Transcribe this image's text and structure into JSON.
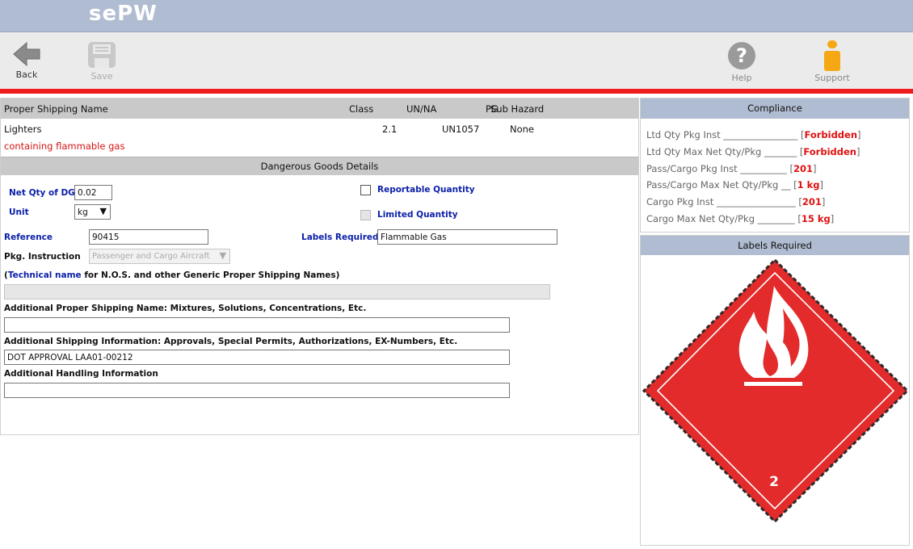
{
  "app": {
    "logo": "sePW"
  },
  "toolbar": {
    "back_label": "Back",
    "save_label": "Save",
    "help_label": "Help",
    "support_label": "Support"
  },
  "shipping_table": {
    "headers": {
      "name": "Proper Shipping Name",
      "class": "Class",
      "un_na": "UN/NA",
      "pg": "PG",
      "sub_hazard": "Sub Hazard"
    },
    "row": {
      "name": "Lighters",
      "description": "containing flammable gas",
      "class": "2.1",
      "un_na": "UN1057",
      "sub_hazard": "None"
    }
  },
  "dg_details": {
    "title": "Dangerous Goods Details",
    "net_qty_label": "Net Qty of DG",
    "net_qty_value": "0.02",
    "unit_label": "Unit",
    "unit_value": "kg",
    "reportable_qty_label": "Reportable Quantity",
    "limited_qty_label": "Limited Quantity",
    "reference_label": "Reference",
    "reference_value": "90415",
    "labels_required_label": "Labels Required",
    "labels_required_value": "Flammable Gas",
    "pkg_instruction_label": "Pkg. Instruction",
    "pkg_instruction_value": "Passenger and Cargo Aircraft",
    "technical_paren_open": "(",
    "technical_name_link": "Technical name",
    "technical_name_rest": " for N.O.S. and other Generic Proper Shipping Names)",
    "technical_name_value": "",
    "addl_psn_label": "Additional Proper Shipping Name: Mixtures, Solutions, Concentrations, Etc.",
    "addl_psn_value": "",
    "addl_ship_info_label": "Additional Shipping Information: Approvals, Special Permits, Authorizations, EX-Numbers, Etc.",
    "addl_ship_info_value": "DOT APPROVAL LAA01-00212",
    "addl_handling_label": "Additional Handling Information",
    "addl_handling_value": ""
  },
  "compliance": {
    "title": "Compliance",
    "rows": [
      {
        "label": "Ltd Qty Pkg Inst ________________",
        "value": "Forbidden"
      },
      {
        "label": "Ltd Qty Max Net Qty/Pkg _______",
        "value": "Forbidden"
      },
      {
        "label": "Pass/Cargo Pkg Inst __________",
        "value": "201"
      },
      {
        "label": "Pass/Cargo Max Net Qty/Pkg __",
        "value": "1 kg"
      },
      {
        "label": "Cargo Pkg Inst _________________",
        "value": "201"
      },
      {
        "label": "Cargo Max Net Qty/Pkg ________",
        "value": "15 kg"
      }
    ]
  },
  "labels_panel": {
    "title": "Labels Required",
    "placard_number": "2",
    "placard_color": "#e32b2b"
  }
}
